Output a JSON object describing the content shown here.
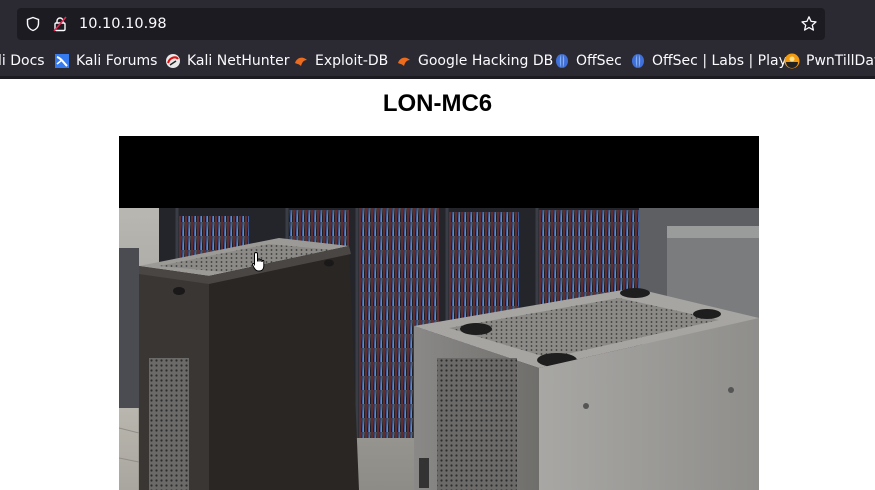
{
  "browser": {
    "url": "10.10.10.98"
  },
  "bookmarks": [
    {
      "label": "li Docs",
      "icon": "kali-docs-icon"
    },
    {
      "label": "Kali Forums",
      "icon": "kali-forums-icon"
    },
    {
      "label": "Kali NetHunter",
      "icon": "kali-nethunter-icon"
    },
    {
      "label": "Exploit-DB",
      "icon": "exploit-db-icon"
    },
    {
      "label": "Google Hacking DB",
      "icon": "ghdb-icon"
    },
    {
      "label": "OffSec",
      "icon": "offsec-icon"
    },
    {
      "label": "OffSec | Labs | Play",
      "icon": "offsec-labs-icon"
    },
    {
      "label": "PwnTillDaw",
      "icon": "pwntilldawn-icon"
    }
  ],
  "page": {
    "title": "LON-MC6",
    "feed_alt": "camera-feed-server-room"
  }
}
